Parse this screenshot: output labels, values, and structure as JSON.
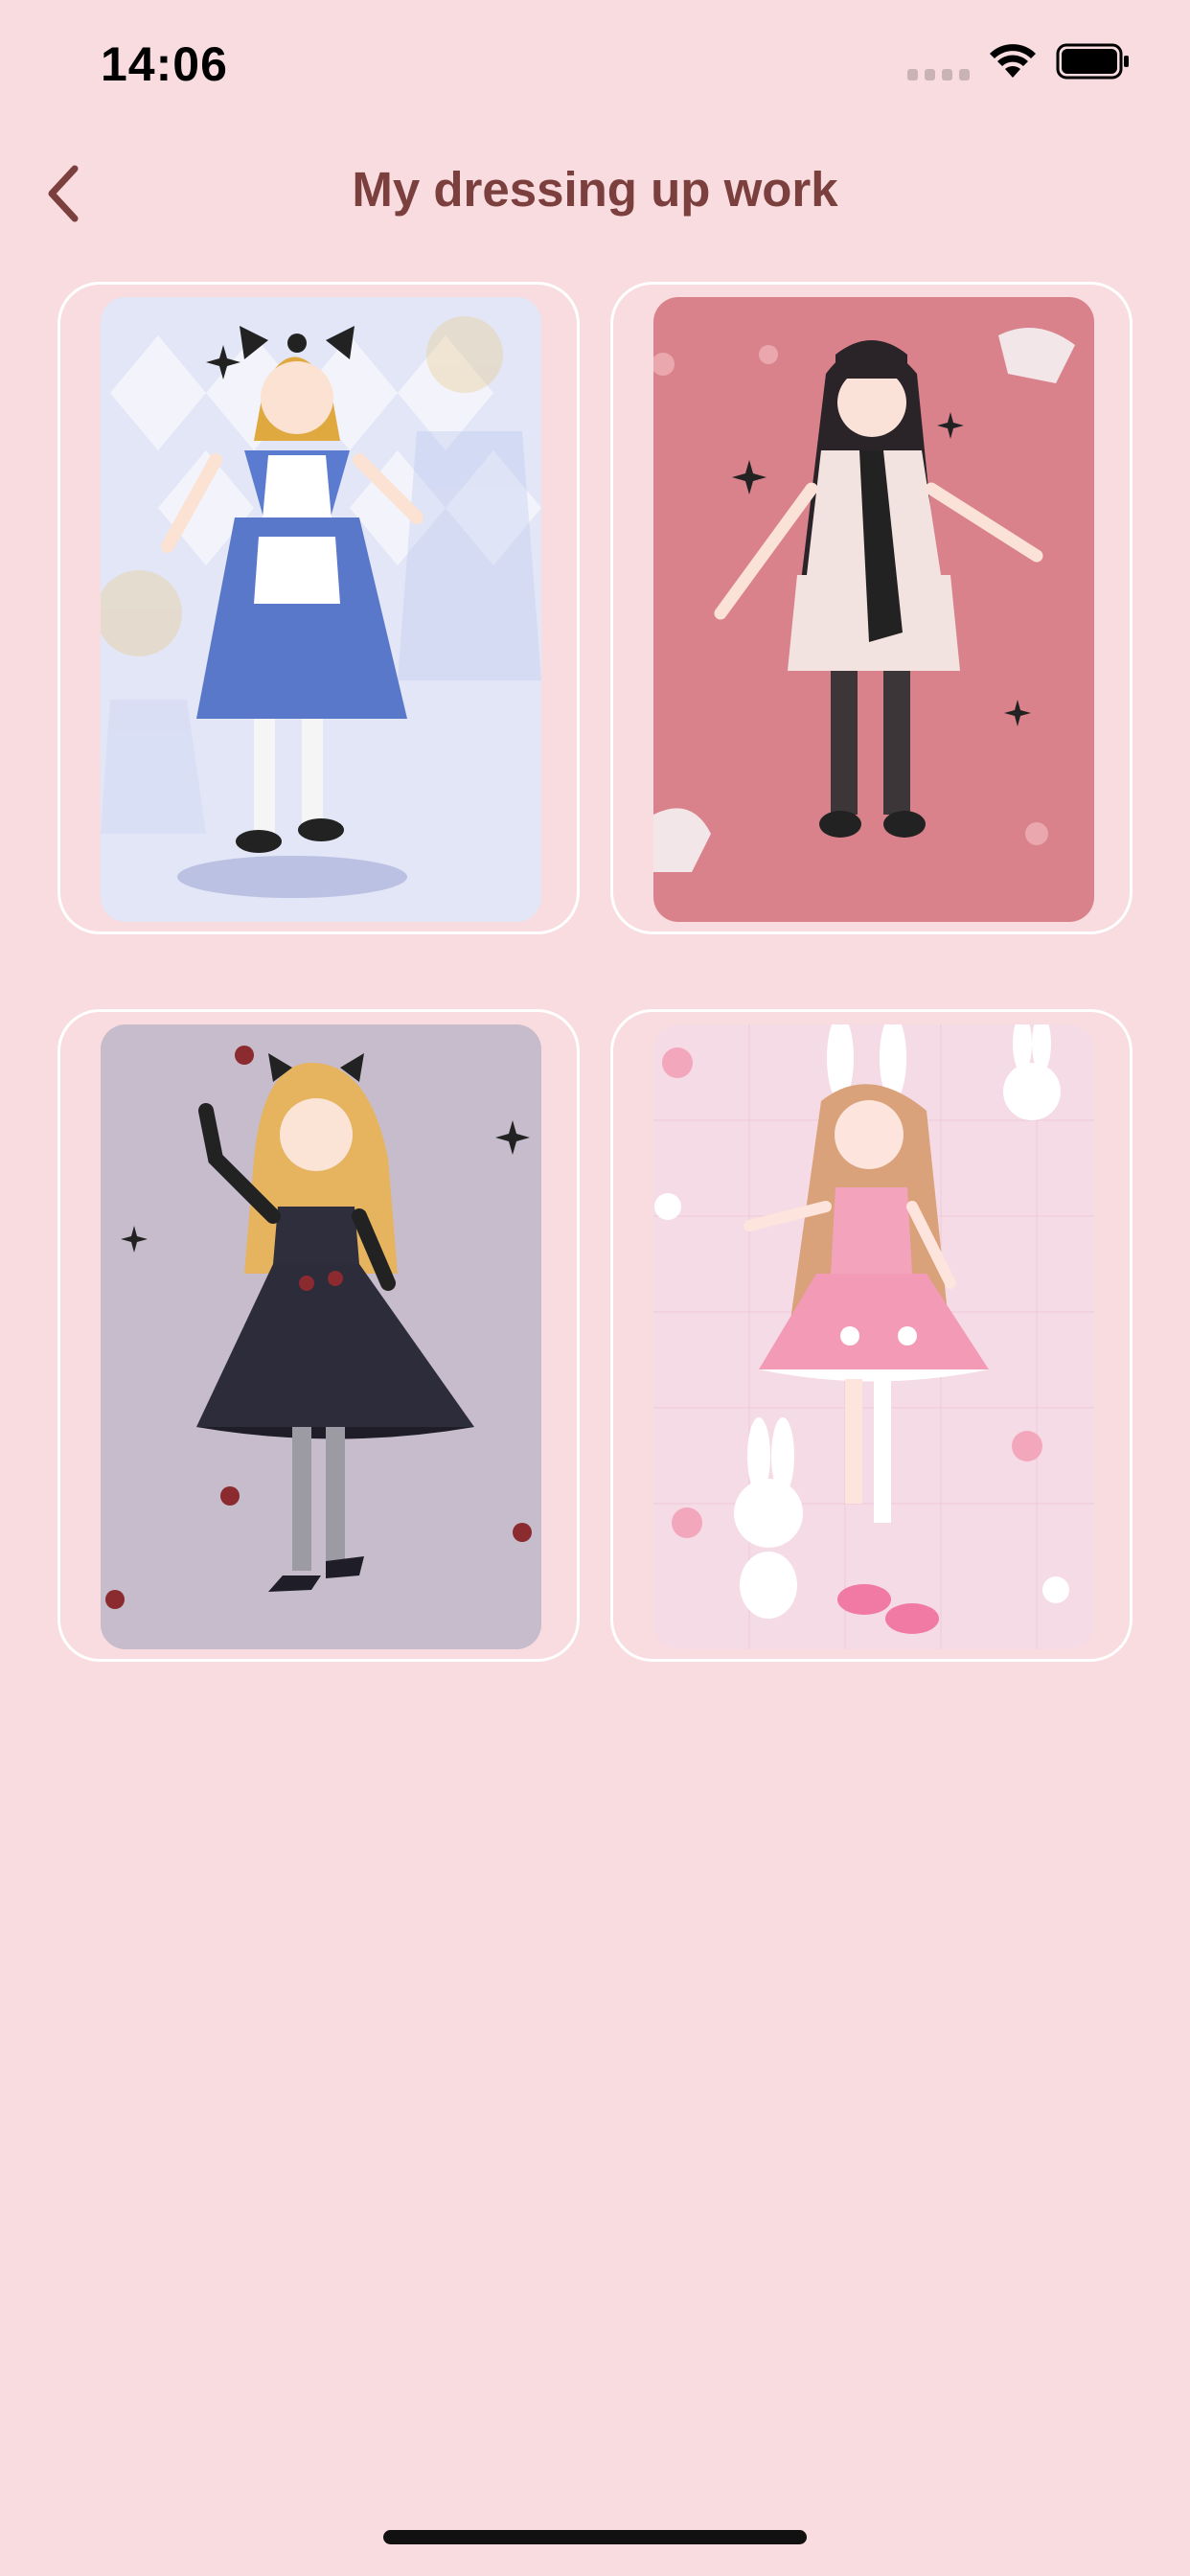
{
  "status_bar": {
    "time": "14:06"
  },
  "header": {
    "title": "My dressing up work",
    "back_icon": "chevron-left-icon"
  },
  "colors": {
    "background": "#f9dcdf",
    "title": "#7b3f3d",
    "card_border": "#ffffff"
  },
  "works": [
    {
      "theme": "alice-blue-dress",
      "background": "#e2e6f6"
    },
    {
      "theme": "gothic-black-white-dress",
      "background": "#d9828c"
    },
    {
      "theme": "black-ball-gown",
      "background": "#c6bccb"
    },
    {
      "theme": "pink-bunny-dress",
      "background": "#f5dbe5"
    }
  ]
}
